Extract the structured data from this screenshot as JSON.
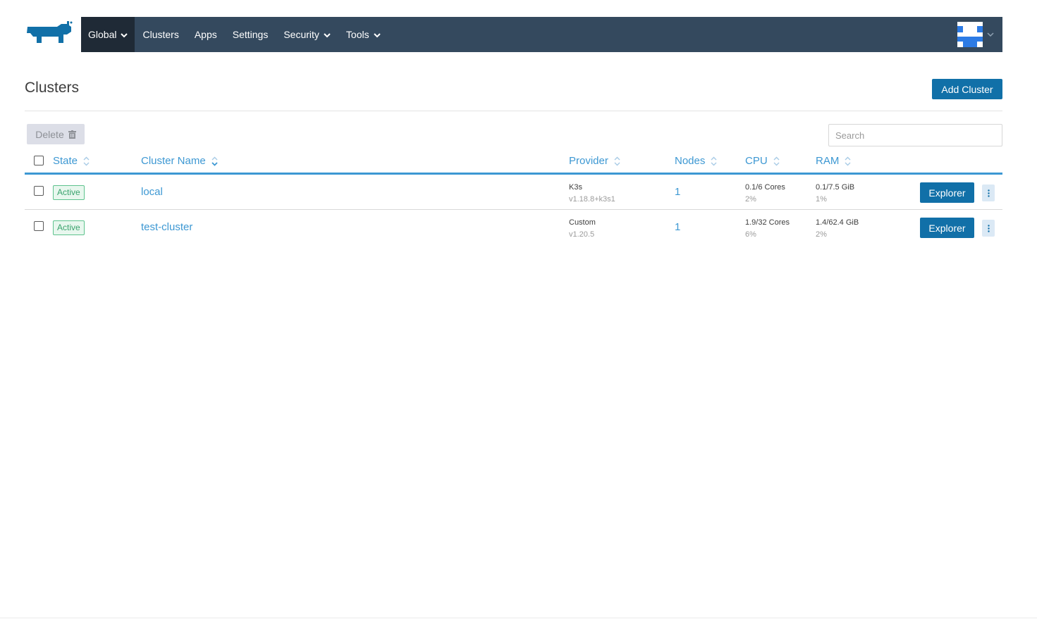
{
  "nav": {
    "logo_icon": "rancher-logo-icon",
    "items": [
      {
        "label": "Global",
        "dropdown": true,
        "active": true
      },
      {
        "label": "Clusters",
        "dropdown": false,
        "active": false
      },
      {
        "label": "Apps",
        "dropdown": false,
        "active": false
      },
      {
        "label": "Settings",
        "dropdown": false,
        "active": false
      },
      {
        "label": "Security",
        "dropdown": true,
        "active": false
      },
      {
        "label": "Tools",
        "dropdown": true,
        "active": false
      }
    ],
    "user_avatar_icon": "user-avatar-icon",
    "colors": {
      "bar": "#34495e",
      "active": "#1f2a36",
      "accent": "#1170a8",
      "link": "#3d98d3"
    }
  },
  "page": {
    "title": "Clusters",
    "add_button": "Add Cluster"
  },
  "toolbar": {
    "delete_label": "Delete",
    "delete_icon": "trash-icon",
    "search_placeholder": "Search"
  },
  "table": {
    "columns": [
      "State",
      "Cluster Name",
      "Provider",
      "Nodes",
      "CPU",
      "RAM"
    ],
    "rows": [
      {
        "state": "Active",
        "name": "local",
        "provider": "K3s",
        "provider_version": "v1.18.8+k3s1",
        "nodes": "1",
        "cpu": "0.1/6 Cores",
        "cpu_pct": "2%",
        "ram": "0.1/7.5 GiB",
        "ram_pct": "1%",
        "action": "Explorer"
      },
      {
        "state": "Active",
        "name": "test-cluster",
        "provider": "Custom",
        "provider_version": "v1.20.5",
        "nodes": "1",
        "cpu": "1.9/32 Cores",
        "cpu_pct": "6%",
        "ram": "1.4/62.4 GiB",
        "ram_pct": "2%",
        "action": "Explorer"
      }
    ]
  }
}
